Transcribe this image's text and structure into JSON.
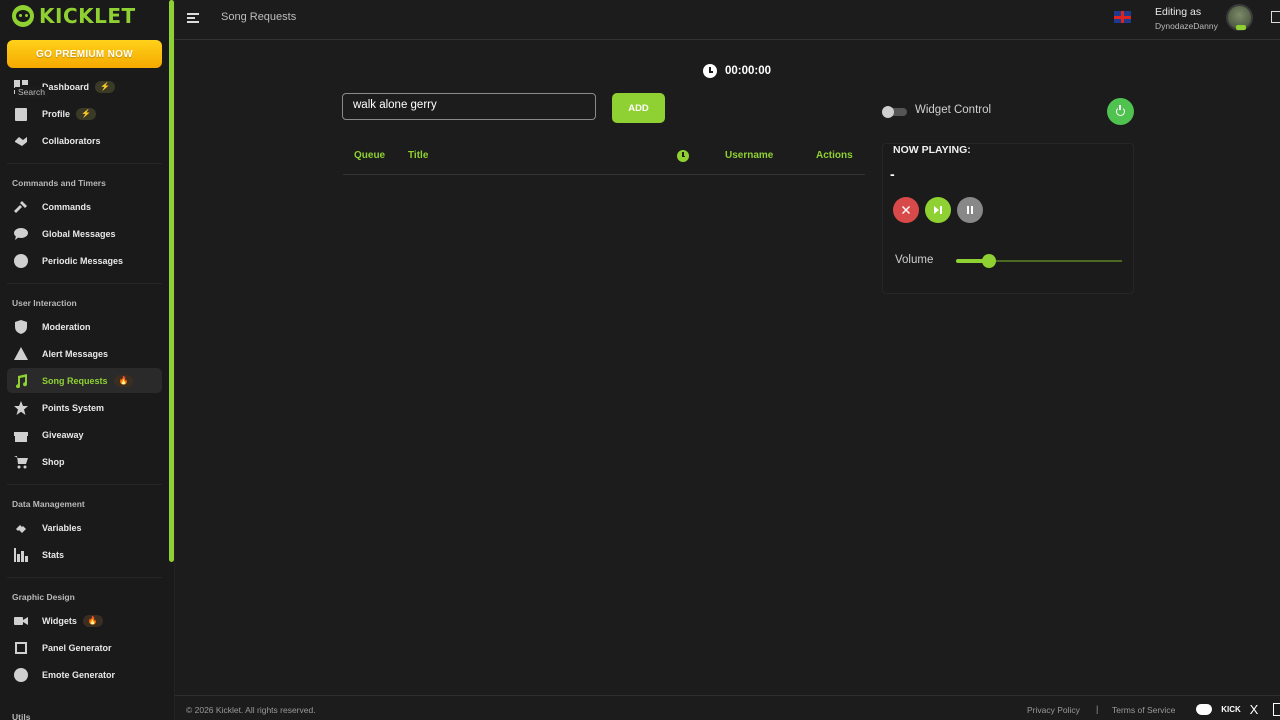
{
  "sidebar": {
    "logo_text": "KICKLET",
    "premium_label": "GO PREMIUM NOW",
    "items": [
      {
        "label": "Dashboard",
        "badge": "⚡"
      },
      {
        "label": "Profile",
        "badge": "⚡"
      },
      {
        "label": "Collaborators"
      },
      {
        "label": "Commands"
      },
      {
        "label": "Global Messages"
      },
      {
        "label": "Periodic Messages"
      },
      {
        "label": "Moderation"
      },
      {
        "label": "Alert Messages"
      },
      {
        "label": "Song Requests",
        "badge": "🔥",
        "active": true
      },
      {
        "label": "Points System"
      },
      {
        "label": "Giveaway"
      },
      {
        "label": "Shop"
      },
      {
        "label": "Variables"
      },
      {
        "label": "Stats"
      },
      {
        "label": "Widgets",
        "badge": "🔥"
      },
      {
        "label": "Panel Generator"
      },
      {
        "label": "Emote Generator"
      }
    ],
    "sections": {
      "commands": "Commands and Timers",
      "user": "User Interaction",
      "data": "Data Management",
      "graphic": "Graphic Design",
      "utils": "Utils"
    }
  },
  "header": {
    "page_title": "Song Requests",
    "editing_as": "Editing as",
    "username": "DynodazeDanny"
  },
  "main": {
    "timer": "00:00:00",
    "search": {
      "label": "Search",
      "value": "walk alone gerry"
    },
    "add_label": "ADD",
    "queue_columns": {
      "queue": "Queue",
      "title": "Title",
      "username": "Username",
      "actions": "Actions"
    },
    "widget_control_label": "Widget Control",
    "widget_control_on": false,
    "now_playing": {
      "title": "NOW PLAYING:",
      "song": "-"
    },
    "volume": {
      "label": "Volume",
      "value": 0.2
    }
  },
  "footer": {
    "copyright": "© 2026 Kicklet. All rights reserved.",
    "privacy": "Privacy Policy",
    "separator": "|",
    "terms": "Terms of Service",
    "kick_label": "KICK",
    "x_label": "X"
  },
  "colors": {
    "accent": "#8fd132",
    "premium": "#f5a900",
    "danger": "#d84a4a"
  }
}
